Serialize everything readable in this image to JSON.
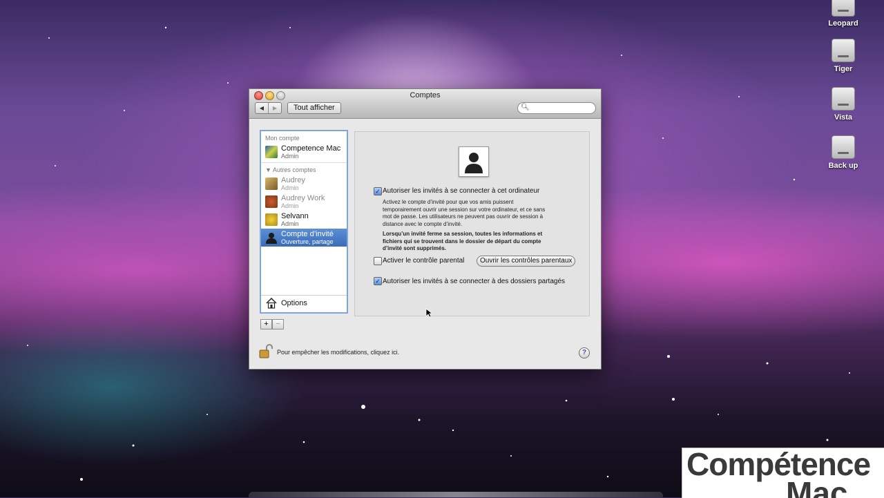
{
  "desktop": {
    "icons": [
      {
        "label": "Leopard"
      },
      {
        "label": "Tiger"
      },
      {
        "label": "Vista"
      },
      {
        "label": "Back up"
      }
    ],
    "logo": {
      "line1": "Compétence",
      "line2": "Mac"
    }
  },
  "window": {
    "title": "Comptes",
    "toolbar": {
      "back": "◀",
      "forward": "▶",
      "show_all": "Tout afficher",
      "search_placeholder": ""
    },
    "accounts": {
      "my_account_header": "Mon compte",
      "my_account": {
        "name": "Competence Mac",
        "role": "Admin"
      },
      "other_header": "Autres comptes",
      "others": [
        {
          "name": "Audrey",
          "role": "Admin"
        },
        {
          "name": "Audrey Work",
          "role": "Admin"
        },
        {
          "name": "Selvann",
          "role": "Admin"
        },
        {
          "name": "Compte d’invité",
          "role": "Ouverture, partage"
        }
      ],
      "options": "Options",
      "add": "+",
      "remove": "−"
    },
    "guest_panel": {
      "allow_login_label": "Autoriser les invités à se connecter à cet ordinateur",
      "allow_login_checked": true,
      "description_lines": [
        "Activez le compte d’invité pour que vos amis puissent",
        "temporairement ouvrir une session sur votre ordinateur, et ce sans",
        "mot de passe. Les utilisateurs ne peuvent pas ouvrir de session à",
        "distance avec le compte d’invité."
      ],
      "warning_lines": [
        "Lorsqu’un invité ferme sa session, toutes les informations et",
        "fichiers qui se trouvent dans le dossier de départ du compte",
        "d’invité sont supprimés."
      ],
      "parental_label": "Activer le contrôle parental",
      "parental_checked": false,
      "parental_button": "Ouvrir les contrôles parentaux",
      "shared_label": "Autoriser les invités à se connecter à des dossiers partagés",
      "shared_checked": true,
      "checkmark": "✓"
    },
    "lock_text": "Pour empêcher les modifications, cliquez ici.",
    "help": "?"
  }
}
